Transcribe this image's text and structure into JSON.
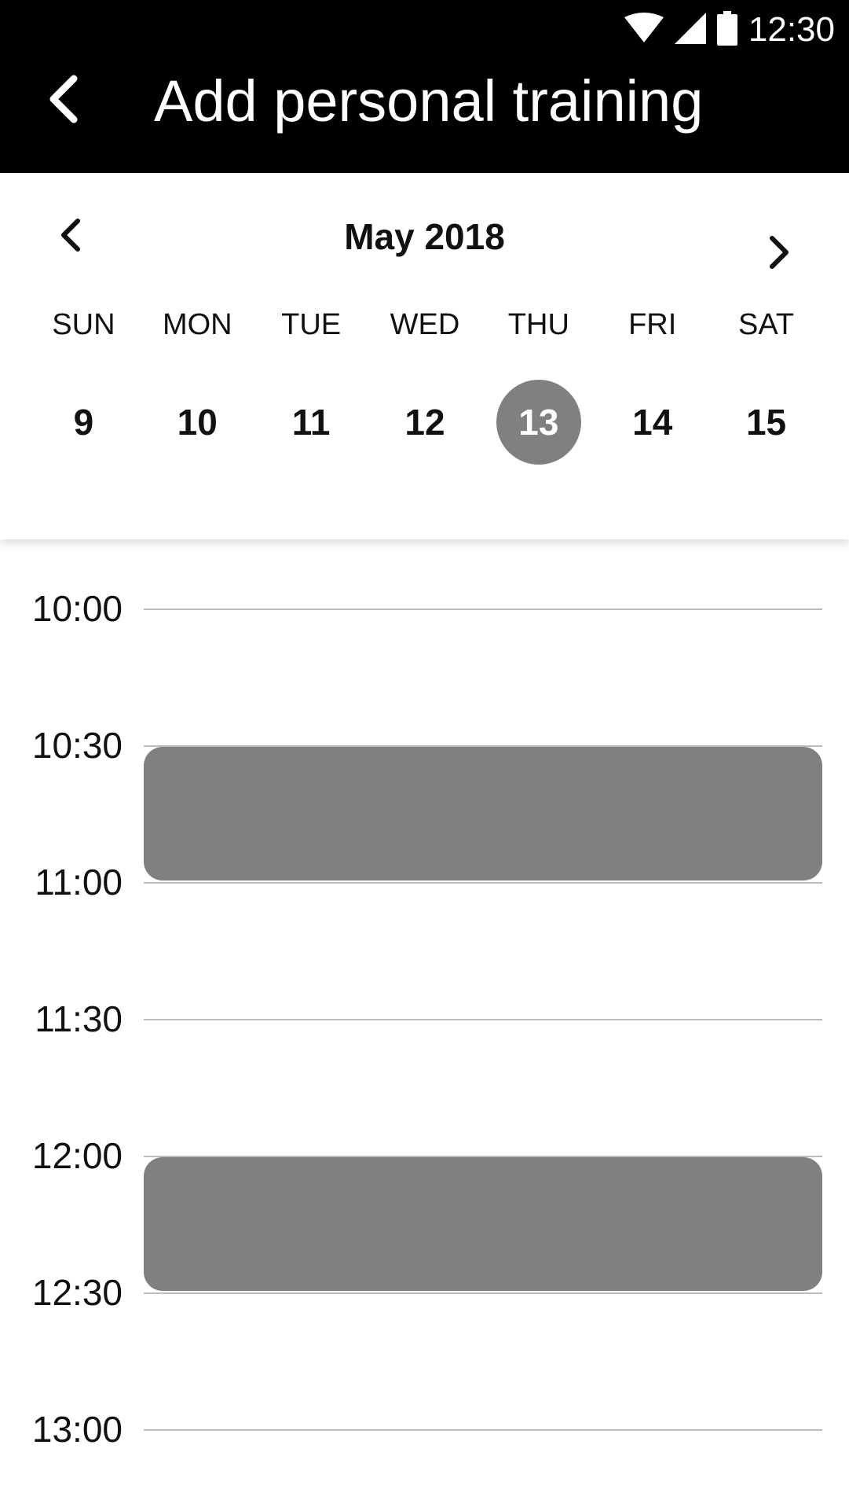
{
  "status_bar": {
    "time": "12:30",
    "icons": [
      "wifi-icon",
      "cellular-signal-icon",
      "battery-icon"
    ]
  },
  "header": {
    "title": "Add personal training",
    "back_icon": "chevron-left-icon"
  },
  "calendar": {
    "month_label": "May 2018",
    "prev_icon": "chevron-left-icon",
    "next_icon": "chevron-right-icon",
    "weekdays": [
      "SUN",
      "MON",
      "TUE",
      "WED",
      "THU",
      "FRI",
      "SAT"
    ],
    "dates": [
      "9",
      "10",
      "11",
      "12",
      "13",
      "14",
      "15"
    ],
    "selected_date": "13"
  },
  "timeline": {
    "slots": [
      "10:00",
      "10:30",
      "11:00",
      "11:30",
      "12:00",
      "12:30",
      "13:00"
    ],
    "bookings": [
      {
        "start": "10:30",
        "end": "11:00"
      },
      {
        "start": "12:00",
        "end": "12:30"
      }
    ]
  },
  "colors": {
    "appbar": "#000000",
    "selected_date": "#808080",
    "booking": "#808080",
    "grid_line": "#bdbdbd"
  }
}
